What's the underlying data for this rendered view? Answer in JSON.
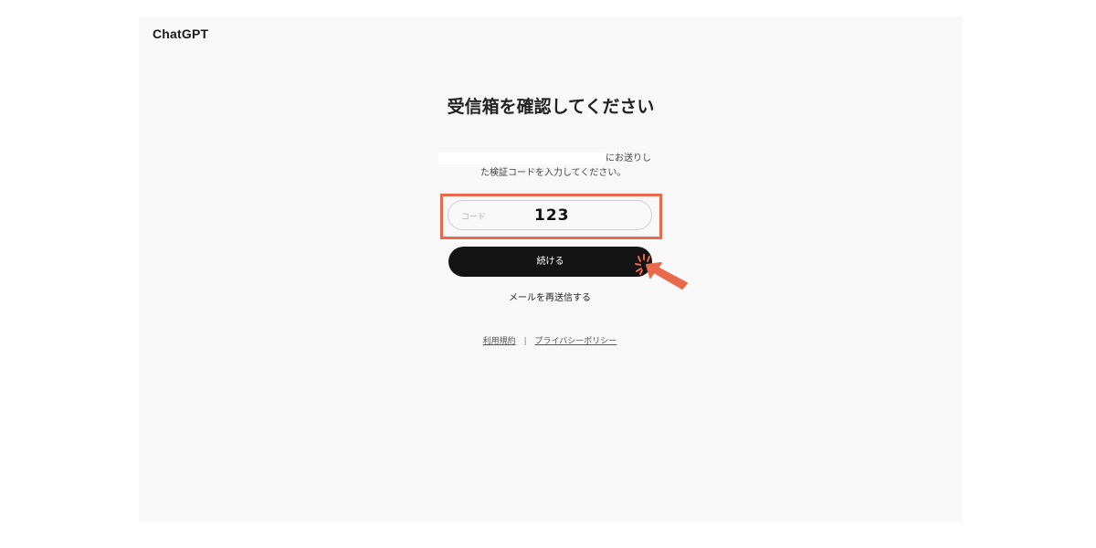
{
  "header": {
    "brand": "ChatGPT"
  },
  "main": {
    "title": "受信箱を確認してください",
    "description_line1": "にお送りし",
    "description_line2": "た検証コードを入力してください。",
    "code_field": {
      "placeholder": "コード",
      "typed_value": "123"
    },
    "continue_label": "続ける",
    "resend_label": "メールを再送信する"
  },
  "footer": {
    "terms_label": "利用規約",
    "separator": "|",
    "privacy_label": "プライバシーポリシー"
  },
  "annotation": {
    "highlight_color": "#e8694b",
    "pointer_icon": "click-cursor-icon"
  },
  "colors": {
    "button_background": "#141414",
    "panel_background": "#f8f8f8"
  }
}
